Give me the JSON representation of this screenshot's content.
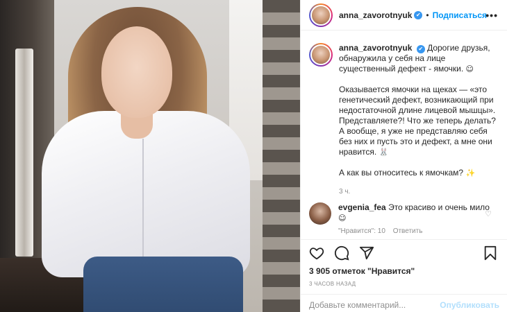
{
  "post": {
    "author": "anna_zavorotnyuk",
    "follow_label": "Подписаться",
    "header_separator": "•",
    "verified_mark": "✔",
    "more_icon": "•••"
  },
  "caption": {
    "username": "anna_zavorotnyuk",
    "paragraph1": "Дорогие друзья, обнаружила у себя на лице существенный дефект - ямочки.",
    "paragraph1_emoji": "☺",
    "paragraph2": "Оказывается ямочки на щеках — «это генетический дефект, возникающий при недостаточной длине лицевой мышцы». Представляете?! Что же теперь делать? А вообще, я уже не представляю себя без них и пусть это и дефект, а мне они нравится.",
    "paragraph2_emoji": "🐰",
    "paragraph3": "А как вы относитесь к ямочкам?",
    "paragraph3_emoji": "✨",
    "time": "3 ч."
  },
  "comment": {
    "username": "evgenia_fea",
    "text": "Это красиво и очень мило",
    "emoji": "☺",
    "likes_label": "\"Нравится\": 10",
    "reply_label": "Ответить",
    "heart_icon": "♡"
  },
  "actions": {
    "like_icon": "heart-icon",
    "comment_icon": "comment-icon",
    "share_icon": "share-icon",
    "save_icon": "bookmark-icon"
  },
  "likes_text": "3 905 отметок \"Нравится\"",
  "timestamp": "3 ЧАСОВ НАЗАД",
  "add_comment": {
    "placeholder": "Добавьте комментарий...",
    "publish_label": "Опубликовать"
  },
  "colors": {
    "accent": "#0095f6",
    "publish_disabled": "#b2dffc",
    "muted": "#8e8e8e",
    "text": "#262626"
  }
}
